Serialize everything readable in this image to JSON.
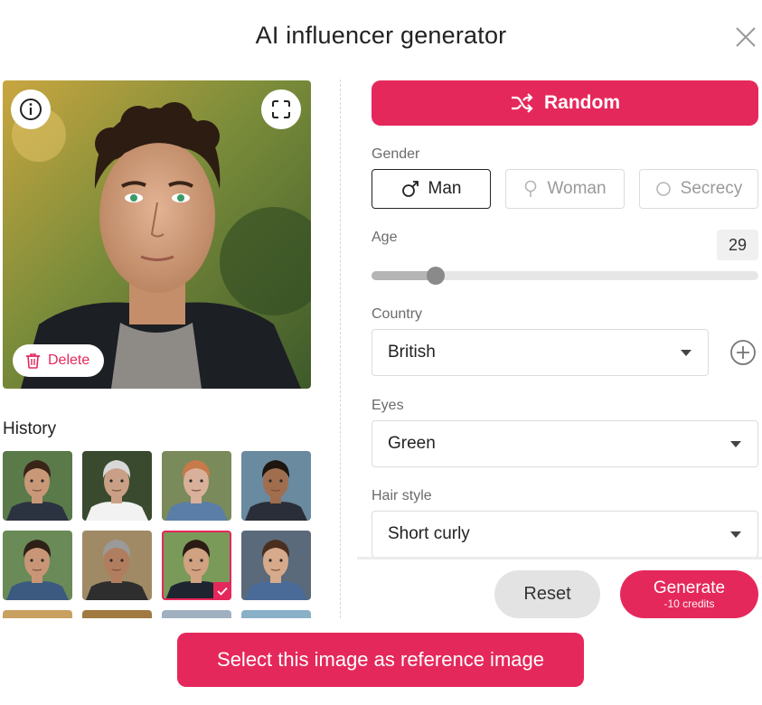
{
  "header": {
    "title": "AI influencer generator"
  },
  "preview": {
    "delete_label": "Delete"
  },
  "history": {
    "label": "History",
    "thumbs": [
      {
        "bg": "#5a7a4a",
        "skin": "#c89878",
        "hair": "#3a2418",
        "shirt": "#2b3340"
      },
      {
        "bg": "#3a4a2e",
        "skin": "#c9a086",
        "hair": "#d8d8d8",
        "shirt": "#f2f2f2"
      },
      {
        "bg": "#7a8a5a",
        "skin": "#d9b09a",
        "hair": "#c87a4a",
        "shirt": "#5a7ea8"
      },
      {
        "bg": "#6a8aa0",
        "skin": "#a06e4e",
        "hair": "#1e1510",
        "shirt": "#2a2e38"
      },
      {
        "bg": "#6a8a58",
        "skin": "#c89676",
        "hair": "#2e2016",
        "shirt": "#3c5a80"
      },
      {
        "bg": "#a08a66",
        "skin": "#b07e5e",
        "hair": "#9a9a9a",
        "shirt": "#2e2e2e"
      },
      {
        "bg": "#7a9a5a",
        "skin": "#d0a282",
        "hair": "#2a1c14",
        "shirt": "#1e2430"
      },
      {
        "bg": "#5a6a7a",
        "skin": "#d6aa8a",
        "hair": "#4a2e1e",
        "shirt": "#4a6a98"
      },
      {
        "bg": "#c8a060",
        "skin": "#d8b090",
        "hair": "#e0d0b0",
        "shirt": "#3a3a3a"
      },
      {
        "bg": "#a07a40",
        "skin": "#b88a6a",
        "hair": "#2a1a12",
        "shirt": "#3a3a3a"
      },
      {
        "bg": "#a0b0c0",
        "skin": "#dcb49a",
        "hair": "#c8b090",
        "shirt": "#5a5a5a"
      },
      {
        "bg": "#8ab0c8",
        "skin": "#c49878",
        "hair": "#1a1410",
        "shirt": "#2a2a2a"
      }
    ],
    "selected_index": 6
  },
  "random": {
    "label": "Random"
  },
  "gender": {
    "label": "Gender",
    "options": [
      {
        "label": "Man"
      },
      {
        "label": "Woman"
      },
      {
        "label": "Secrecy"
      }
    ],
    "selected": "Man"
  },
  "age": {
    "label": "Age",
    "value": "29",
    "fraction": 0.165
  },
  "country": {
    "label": "Country",
    "value": "British"
  },
  "eyes": {
    "label": "Eyes",
    "value": "Green"
  },
  "hair": {
    "label": "Hair style",
    "value": "Short curly"
  },
  "actions": {
    "reset": "Reset",
    "generate": "Generate",
    "credits": "-10 credits"
  },
  "footer": {
    "select_ref": "Select this image as reference image"
  },
  "colors": {
    "accent": "#e5285b",
    "accent_text": "#ffffff"
  }
}
